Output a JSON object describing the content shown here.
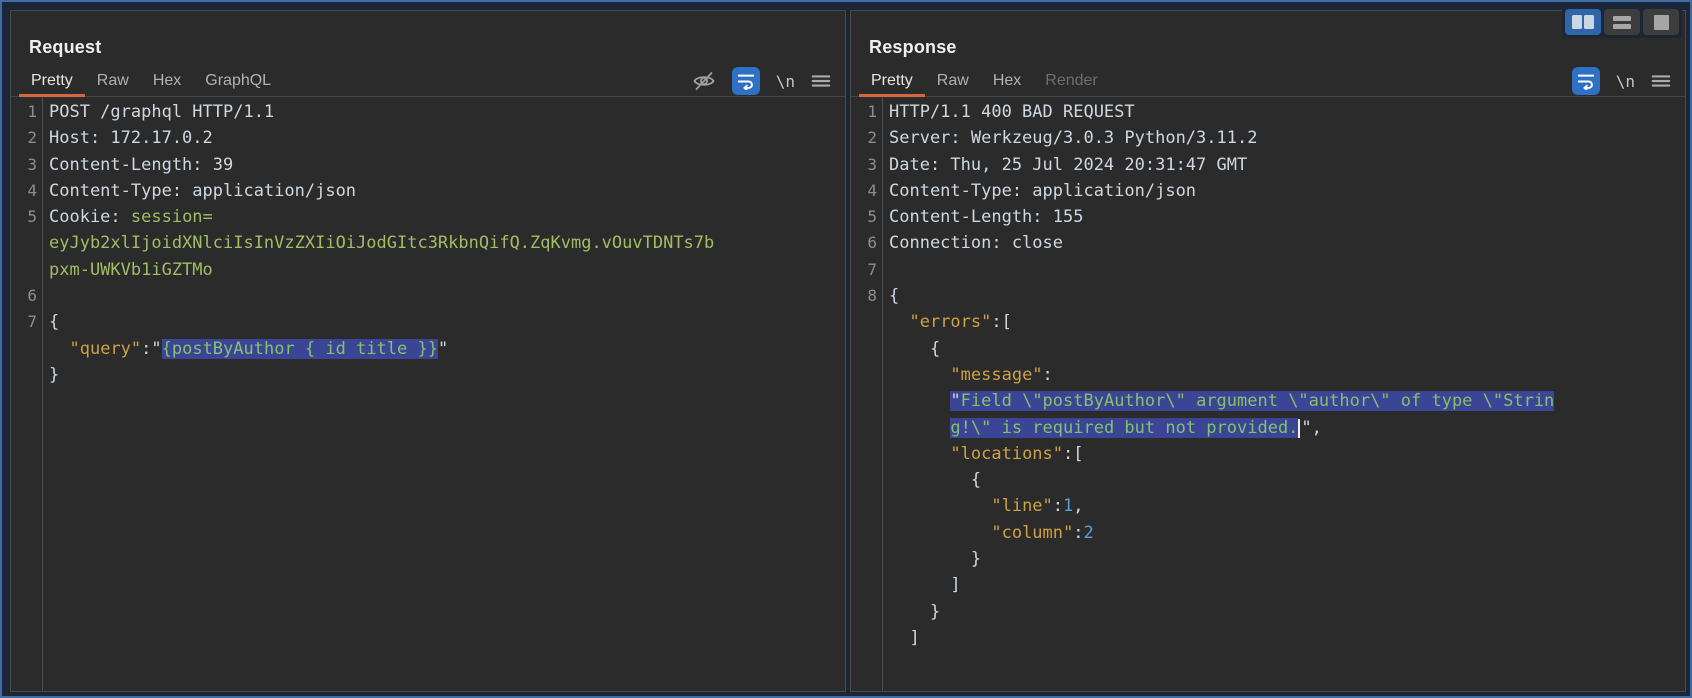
{
  "layout_switch": {
    "buttons": [
      {
        "name": "split-vertical",
        "state": "active"
      },
      {
        "name": "split-horizontal",
        "state": "inactive"
      },
      {
        "name": "single-pane",
        "state": "inactive"
      }
    ],
    "active_color": "#2f66a8"
  },
  "colors": {
    "accent_orange": "#d4683f",
    "selection_background": "#3c4496",
    "wrap_button_blue": "#2e71c4",
    "string_green": "#a2bd63",
    "key_gold": "#cfa144",
    "number_blue": "#5e9ed9",
    "panel_background": "#2b2b2b",
    "window_background": "#1c2637"
  },
  "request_panel": {
    "title": "Request",
    "tabs": [
      {
        "label": "Pretty",
        "state": "active"
      },
      {
        "label": "Raw",
        "state": "normal"
      },
      {
        "label": "Hex",
        "state": "normal"
      },
      {
        "label": "GraphQL",
        "state": "normal"
      }
    ],
    "toolbar": {
      "newline_label": "\\n"
    },
    "rows": [
      {
        "num": "1",
        "segs": [
          [
            "d",
            "POST /graphql HTTP/1.1"
          ]
        ]
      },
      {
        "num": "2",
        "segs": [
          [
            "d",
            "Host: 172.17.0.2"
          ]
        ]
      },
      {
        "num": "3",
        "segs": [
          [
            "d",
            "Content-Length: 39"
          ]
        ]
      },
      {
        "num": "4",
        "segs": [
          [
            "d",
            "Content-Type: application/json"
          ]
        ]
      },
      {
        "num": "5",
        "segs": [
          [
            "d",
            "Cookie: "
          ],
          [
            "g",
            "session="
          ]
        ]
      },
      {
        "num": "",
        "segs": [
          [
            "g",
            "eyJyb2xlIjoidXNlciIsInVzZXIiOiJodGItc3RkbnQifQ.ZqKvmg.vOuvTDNTs7b"
          ]
        ]
      },
      {
        "num": "",
        "segs": [
          [
            "g",
            "pxm-UWKVb1iGZTMo"
          ]
        ]
      },
      {
        "num": "6",
        "segs": []
      },
      {
        "num": "7",
        "segs": [
          [
            "d",
            "{"
          ]
        ]
      },
      {
        "num": "",
        "segs": [
          [
            "d",
            "  "
          ],
          [
            "k",
            "\"query\""
          ],
          [
            "d",
            ":\""
          ],
          [
            "sg",
            "{postByAuthor { id title }}"
          ],
          [
            "d",
            "\""
          ]
        ]
      },
      {
        "num": "",
        "segs": [
          [
            "d",
            "}"
          ]
        ]
      }
    ]
  },
  "response_panel": {
    "title": "Response",
    "tabs": [
      {
        "label": "Pretty",
        "state": "active"
      },
      {
        "label": "Raw",
        "state": "normal"
      },
      {
        "label": "Hex",
        "state": "normal"
      },
      {
        "label": "Render",
        "state": "disabled"
      }
    ],
    "toolbar": {
      "newline_label": "\\n"
    },
    "rows": [
      {
        "num": "1",
        "segs": [
          [
            "d",
            "HTTP/1.1 400 BAD REQUEST"
          ]
        ]
      },
      {
        "num": "2",
        "segs": [
          [
            "d",
            "Server: Werkzeug/3.0.3 Python/3.11.2"
          ]
        ]
      },
      {
        "num": "3",
        "segs": [
          [
            "d",
            "Date: Thu, 25 Jul 2024 20:31:47 GMT"
          ]
        ]
      },
      {
        "num": "4",
        "segs": [
          [
            "d",
            "Content-Type: application/json"
          ]
        ]
      },
      {
        "num": "5",
        "segs": [
          [
            "d",
            "Content-Length: 155"
          ]
        ]
      },
      {
        "num": "6",
        "segs": [
          [
            "d",
            "Connection: close"
          ]
        ]
      },
      {
        "num": "7",
        "segs": []
      },
      {
        "num": "8",
        "segs": [
          [
            "d",
            "{"
          ]
        ]
      },
      {
        "num": "",
        "segs": [
          [
            "d",
            "  "
          ],
          [
            "k",
            "\"errors\""
          ],
          [
            "d",
            ":["
          ]
        ]
      },
      {
        "num": "",
        "segs": [
          [
            "d",
            "    {"
          ]
        ]
      },
      {
        "num": "",
        "segs": [
          [
            "d",
            "      "
          ],
          [
            "k",
            "\"message\""
          ],
          [
            "d",
            ":"
          ]
        ]
      },
      {
        "num": "",
        "segs": [
          [
            "d",
            "      "
          ],
          [
            "sw",
            "\""
          ],
          [
            "sg",
            "Field \\\"postByAuthor\\\" argument \\\"author\\\" of type \\\"Strin"
          ]
        ]
      },
      {
        "num": "",
        "segs": [
          [
            "d",
            "      "
          ],
          [
            "sg",
            "g!\\\" is required but not provided."
          ],
          [
            "cur",
            ""
          ],
          [
            "d",
            "\","
          ]
        ]
      },
      {
        "num": "",
        "segs": [
          [
            "d",
            "      "
          ],
          [
            "k",
            "\"locations\""
          ],
          [
            "d",
            ":["
          ]
        ]
      },
      {
        "num": "",
        "segs": [
          [
            "d",
            "        {"
          ]
        ]
      },
      {
        "num": "",
        "segs": [
          [
            "d",
            "          "
          ],
          [
            "k",
            "\"line\""
          ],
          [
            "d",
            ":"
          ],
          [
            "n",
            "1"
          ],
          [
            "d",
            ","
          ]
        ]
      },
      {
        "num": "",
        "segs": [
          [
            "d",
            "          "
          ],
          [
            "k",
            "\"column\""
          ],
          [
            "d",
            ":"
          ],
          [
            "n",
            "2"
          ]
        ]
      },
      {
        "num": "",
        "segs": [
          [
            "d",
            "        }"
          ]
        ]
      },
      {
        "num": "",
        "segs": [
          [
            "d",
            "      ]"
          ]
        ]
      },
      {
        "num": "",
        "segs": [
          [
            "d",
            "    }"
          ]
        ]
      },
      {
        "num": "",
        "segs": [
          [
            "d",
            "  ]"
          ]
        ]
      }
    ]
  }
}
